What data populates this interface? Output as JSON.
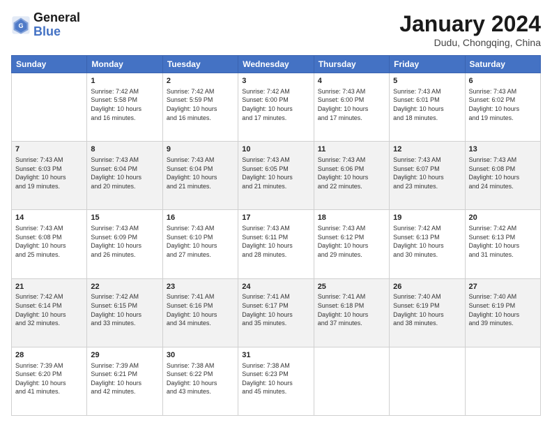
{
  "header": {
    "logo_general": "General",
    "logo_blue": "Blue",
    "title": "January 2024",
    "subtitle": "Dudu, Chongqing, China"
  },
  "weekdays": [
    "Sunday",
    "Monday",
    "Tuesday",
    "Wednesday",
    "Thursday",
    "Friday",
    "Saturday"
  ],
  "weeks": [
    [
      {
        "day": "",
        "sunrise": "",
        "sunset": "",
        "daylight": ""
      },
      {
        "day": "1",
        "sunrise": "Sunrise: 7:42 AM",
        "sunset": "Sunset: 5:58 PM",
        "daylight": "Daylight: 10 hours and 16 minutes."
      },
      {
        "day": "2",
        "sunrise": "Sunrise: 7:42 AM",
        "sunset": "Sunset: 5:59 PM",
        "daylight": "Daylight: 10 hours and 16 minutes."
      },
      {
        "day": "3",
        "sunrise": "Sunrise: 7:42 AM",
        "sunset": "Sunset: 6:00 PM",
        "daylight": "Daylight: 10 hours and 17 minutes."
      },
      {
        "day": "4",
        "sunrise": "Sunrise: 7:43 AM",
        "sunset": "Sunset: 6:00 PM",
        "daylight": "Daylight: 10 hours and 17 minutes."
      },
      {
        "day": "5",
        "sunrise": "Sunrise: 7:43 AM",
        "sunset": "Sunset: 6:01 PM",
        "daylight": "Daylight: 10 hours and 18 minutes."
      },
      {
        "day": "6",
        "sunrise": "Sunrise: 7:43 AM",
        "sunset": "Sunset: 6:02 PM",
        "daylight": "Daylight: 10 hours and 19 minutes."
      }
    ],
    [
      {
        "day": "7",
        "sunrise": "Sunrise: 7:43 AM",
        "sunset": "Sunset: 6:03 PM",
        "daylight": "Daylight: 10 hours and 19 minutes."
      },
      {
        "day": "8",
        "sunrise": "Sunrise: 7:43 AM",
        "sunset": "Sunset: 6:04 PM",
        "daylight": "Daylight: 10 hours and 20 minutes."
      },
      {
        "day": "9",
        "sunrise": "Sunrise: 7:43 AM",
        "sunset": "Sunset: 6:04 PM",
        "daylight": "Daylight: 10 hours and 21 minutes."
      },
      {
        "day": "10",
        "sunrise": "Sunrise: 7:43 AM",
        "sunset": "Sunset: 6:05 PM",
        "daylight": "Daylight: 10 hours and 21 minutes."
      },
      {
        "day": "11",
        "sunrise": "Sunrise: 7:43 AM",
        "sunset": "Sunset: 6:06 PM",
        "daylight": "Daylight: 10 hours and 22 minutes."
      },
      {
        "day": "12",
        "sunrise": "Sunrise: 7:43 AM",
        "sunset": "Sunset: 6:07 PM",
        "daylight": "Daylight: 10 hours and 23 minutes."
      },
      {
        "day": "13",
        "sunrise": "Sunrise: 7:43 AM",
        "sunset": "Sunset: 6:08 PM",
        "daylight": "Daylight: 10 hours and 24 minutes."
      }
    ],
    [
      {
        "day": "14",
        "sunrise": "Sunrise: 7:43 AM",
        "sunset": "Sunset: 6:08 PM",
        "daylight": "Daylight: 10 hours and 25 minutes."
      },
      {
        "day": "15",
        "sunrise": "Sunrise: 7:43 AM",
        "sunset": "Sunset: 6:09 PM",
        "daylight": "Daylight: 10 hours and 26 minutes."
      },
      {
        "day": "16",
        "sunrise": "Sunrise: 7:43 AM",
        "sunset": "Sunset: 6:10 PM",
        "daylight": "Daylight: 10 hours and 27 minutes."
      },
      {
        "day": "17",
        "sunrise": "Sunrise: 7:43 AM",
        "sunset": "Sunset: 6:11 PM",
        "daylight": "Daylight: 10 hours and 28 minutes."
      },
      {
        "day": "18",
        "sunrise": "Sunrise: 7:43 AM",
        "sunset": "Sunset: 6:12 PM",
        "daylight": "Daylight: 10 hours and 29 minutes."
      },
      {
        "day": "19",
        "sunrise": "Sunrise: 7:42 AM",
        "sunset": "Sunset: 6:13 PM",
        "daylight": "Daylight: 10 hours and 30 minutes."
      },
      {
        "day": "20",
        "sunrise": "Sunrise: 7:42 AM",
        "sunset": "Sunset: 6:13 PM",
        "daylight": "Daylight: 10 hours and 31 minutes."
      }
    ],
    [
      {
        "day": "21",
        "sunrise": "Sunrise: 7:42 AM",
        "sunset": "Sunset: 6:14 PM",
        "daylight": "Daylight: 10 hours and 32 minutes."
      },
      {
        "day": "22",
        "sunrise": "Sunrise: 7:42 AM",
        "sunset": "Sunset: 6:15 PM",
        "daylight": "Daylight: 10 hours and 33 minutes."
      },
      {
        "day": "23",
        "sunrise": "Sunrise: 7:41 AM",
        "sunset": "Sunset: 6:16 PM",
        "daylight": "Daylight: 10 hours and 34 minutes."
      },
      {
        "day": "24",
        "sunrise": "Sunrise: 7:41 AM",
        "sunset": "Sunset: 6:17 PM",
        "daylight": "Daylight: 10 hours and 35 minutes."
      },
      {
        "day": "25",
        "sunrise": "Sunrise: 7:41 AM",
        "sunset": "Sunset: 6:18 PM",
        "daylight": "Daylight: 10 hours and 37 minutes."
      },
      {
        "day": "26",
        "sunrise": "Sunrise: 7:40 AM",
        "sunset": "Sunset: 6:19 PM",
        "daylight": "Daylight: 10 hours and 38 minutes."
      },
      {
        "day": "27",
        "sunrise": "Sunrise: 7:40 AM",
        "sunset": "Sunset: 6:19 PM",
        "daylight": "Daylight: 10 hours and 39 minutes."
      }
    ],
    [
      {
        "day": "28",
        "sunrise": "Sunrise: 7:39 AM",
        "sunset": "Sunset: 6:20 PM",
        "daylight": "Daylight: 10 hours and 41 minutes."
      },
      {
        "day": "29",
        "sunrise": "Sunrise: 7:39 AM",
        "sunset": "Sunset: 6:21 PM",
        "daylight": "Daylight: 10 hours and 42 minutes."
      },
      {
        "day": "30",
        "sunrise": "Sunrise: 7:38 AM",
        "sunset": "Sunset: 6:22 PM",
        "daylight": "Daylight: 10 hours and 43 minutes."
      },
      {
        "day": "31",
        "sunrise": "Sunrise: 7:38 AM",
        "sunset": "Sunset: 6:23 PM",
        "daylight": "Daylight: 10 hours and 45 minutes."
      },
      {
        "day": "",
        "sunrise": "",
        "sunset": "",
        "daylight": ""
      },
      {
        "day": "",
        "sunrise": "",
        "sunset": "",
        "daylight": ""
      },
      {
        "day": "",
        "sunrise": "",
        "sunset": "",
        "daylight": ""
      }
    ]
  ]
}
